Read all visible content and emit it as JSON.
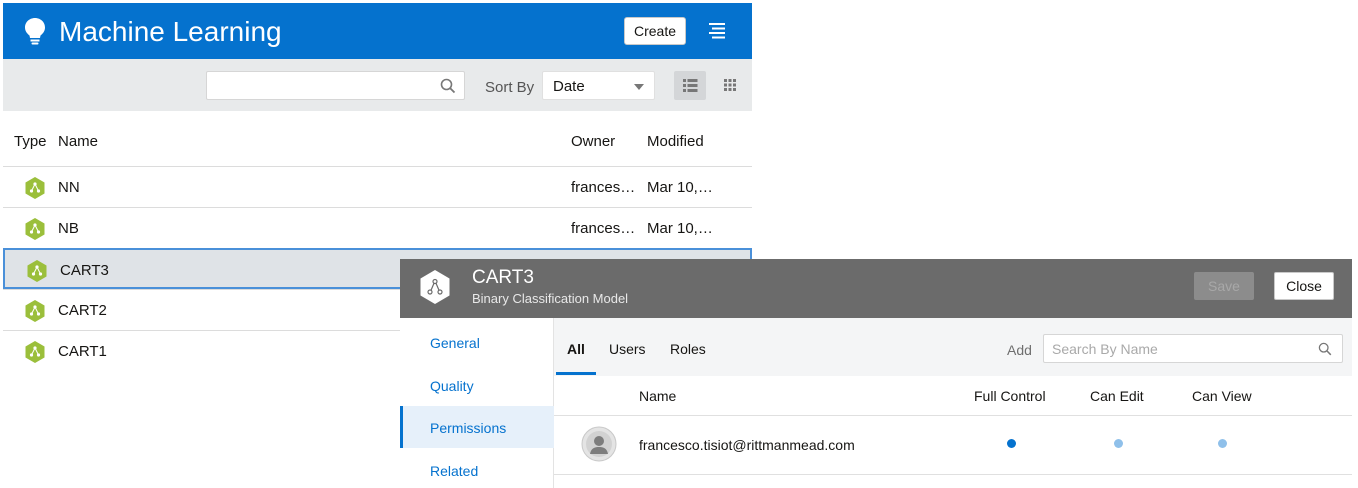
{
  "ml": {
    "title": "Machine Learning",
    "create_label": "Create",
    "search": {
      "value": "",
      "placeholder": ""
    },
    "sort_by_label": "Sort By",
    "sort_value": "Date",
    "columns": {
      "type": "Type",
      "name": "Name",
      "owner": "Owner",
      "modified": "Modified"
    },
    "rows": [
      {
        "name": "NN",
        "owner": "frances…",
        "modified": "Mar 10,…"
      },
      {
        "name": "NB",
        "owner": "frances…",
        "modified": "Mar 10,…"
      },
      {
        "name": "CART3",
        "owner": "",
        "modified": ""
      },
      {
        "name": "CART2",
        "owner": "",
        "modified": ""
      },
      {
        "name": "CART1",
        "owner": "",
        "modified": ""
      }
    ],
    "selected_row": "CART3",
    "model_icon_color": "#9bbf3b",
    "header_color": "#0572ce"
  },
  "dialog": {
    "title": "CART3",
    "subtitle": "Binary Classification Model",
    "save_label": "Save",
    "close_label": "Close",
    "sidebar": [
      {
        "label": "General"
      },
      {
        "label": "Quality"
      },
      {
        "label": "Permissions"
      },
      {
        "label": "Related"
      }
    ],
    "active_sidebar": "Permissions",
    "tabs": [
      {
        "label": "All"
      },
      {
        "label": "Users"
      },
      {
        "label": "Roles"
      }
    ],
    "active_tab": "All",
    "add_label": "Add",
    "search_placeholder": "Search By Name",
    "columns": {
      "name": "Name",
      "full_control": "Full Control",
      "can_edit": "Can Edit",
      "can_view": "Can View"
    },
    "users": [
      {
        "email": "francesco.tisiot@rittmanmead.com",
        "full_control": true,
        "can_edit": false,
        "can_view": false
      }
    ],
    "header_color": "#6b6b6b"
  }
}
